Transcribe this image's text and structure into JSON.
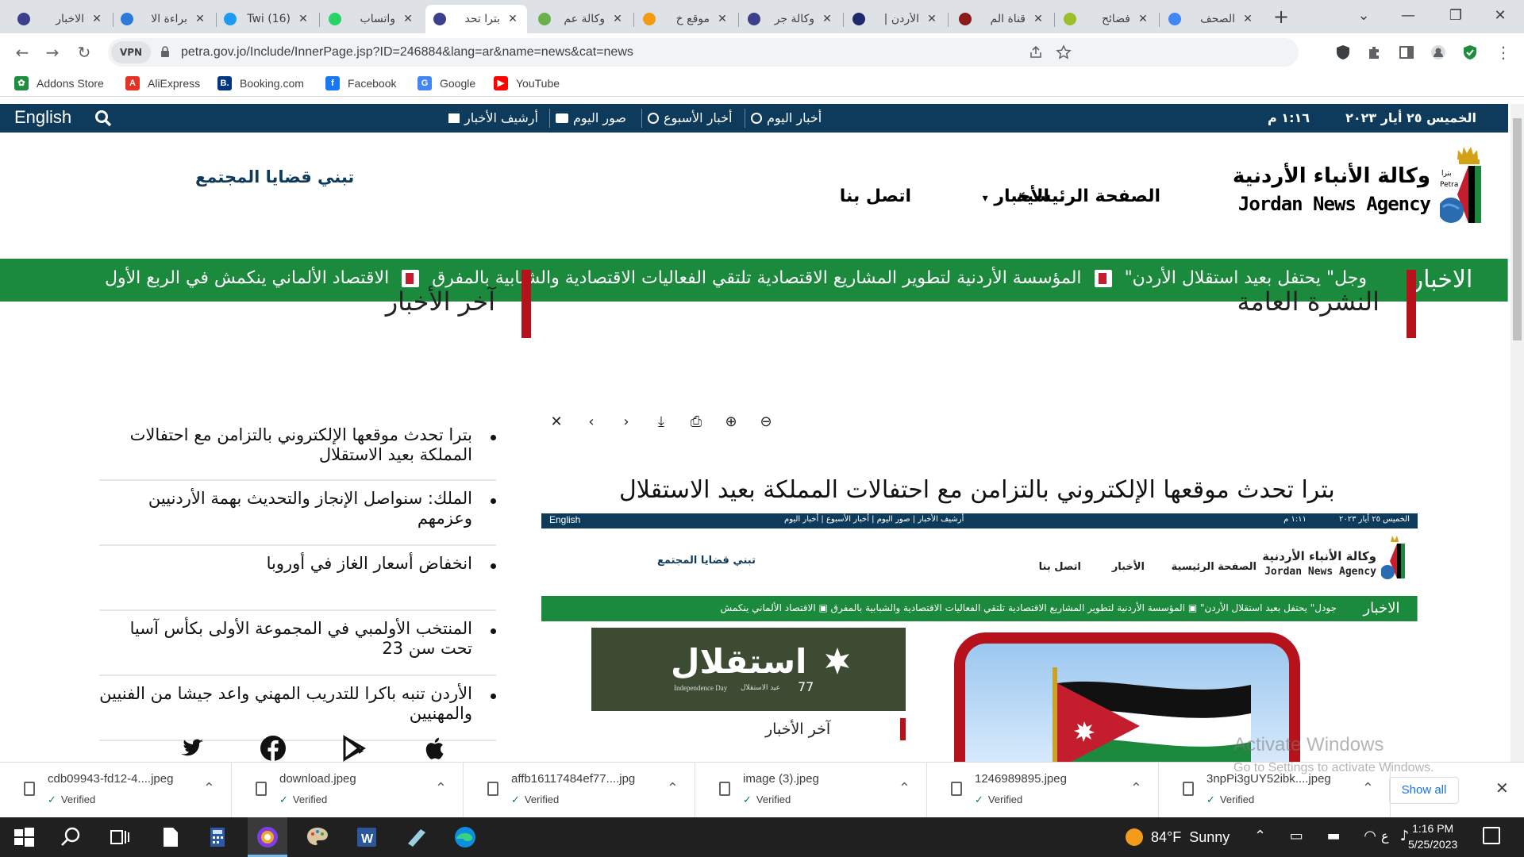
{
  "browser": {
    "tabs": [
      {
        "title": "الاخبار",
        "favicon_color": "#3b3f8c",
        "active": false
      },
      {
        "title": "براءة الا",
        "favicon_color": "#2a7bd5",
        "active": false
      },
      {
        "title": "(16) Twi",
        "favicon_color": "#1d9bf0",
        "active": false
      },
      {
        "title": "واتساب",
        "favicon_color": "#25d366",
        "active": false
      },
      {
        "title": "بترا تحد",
        "favicon_color": "#3b3f8c",
        "active": true
      },
      {
        "title": "وكالة عم",
        "favicon_color": "#6ab04c",
        "active": false
      },
      {
        "title": "موقع خ",
        "favicon_color": "#f39c12",
        "active": false
      },
      {
        "title": "وكالة جر",
        "favicon_color": "#3b3f8c",
        "active": false
      },
      {
        "title": "الأردن |",
        "favicon_color": "#1e2a6e",
        "active": false
      },
      {
        "title": "قناة الم",
        "favicon_color": "#8b1a1a",
        "active": false
      },
      {
        "title": "فضائح",
        "favicon_color": "#9bbf2a",
        "active": false
      },
      {
        "title": "الصحف",
        "favicon_color": "#4285f4",
        "active": false
      }
    ],
    "window_controls": {
      "menu": "⌄",
      "minimize": "—",
      "maximize": "❐",
      "close": "✕"
    },
    "url": "petra.gov.jo/Include/InnerPage.jsp?ID=246884&lang=ar&name=news&cat=news",
    "vpn_label": "VPN",
    "bookmarks": [
      {
        "label": "Addons Store",
        "color": "#1e8e3e",
        "glyph": "✿"
      },
      {
        "label": "AliExpress",
        "color": "#e43225",
        "glyph": "A"
      },
      {
        "label": "Booking.com",
        "color": "#003580",
        "glyph": "B."
      },
      {
        "label": "Facebook",
        "color": "#1877f2",
        "glyph": "f"
      },
      {
        "label": "Google",
        "color": "#4285f4",
        "glyph": "G"
      },
      {
        "label": "YouTube",
        "color": "#ff0000",
        "glyph": "▶"
      }
    ]
  },
  "site": {
    "top_bar": {
      "english": "English",
      "links": [
        "أرشيف الأخبار",
        "صور اليوم",
        "أخبار الأسبوع",
        "أخبار اليوم"
      ],
      "time": "١:١٦ م",
      "date": "الخميس ٢٥ أيار ٢٠٢٣"
    },
    "logo": {
      "arabic": "وكالة الأنباء الأردنية",
      "english": "Jordan News Agency",
      "badge": "بترا Petra"
    },
    "nav": {
      "home": "الصفحة الرئيسية",
      "news": "الأخبار",
      "news_arrow": "▾",
      "contact": "اتصل بنا"
    },
    "slogan": "تبني قضايا المجتمع",
    "ticker": {
      "label": "الاخبار",
      "items": [
        "وجل\" يحتفل بعيد استقلال الأردن\"",
        "المؤسسة الأردنية لتطوير المشاريع الاقتصادية تلتقي الفعاليات الاقتصادية والشبابية بالمفرق",
        "الاقتصاد الألماني ينكمش في الربع الأول"
      ]
    },
    "general_bulletin": "النشرة العامة",
    "latest_news_heading": "آخر الأخبار",
    "viewer_toolbar": [
      "zoom-out",
      "zoom-in",
      "print",
      "download",
      "next",
      "previous",
      "close"
    ],
    "viewer_glyphs": {
      "close": "✕",
      "previous": "‹",
      "next": "›",
      "download": "⤓",
      "print": "⎙",
      "zoom_in": "⊕",
      "zoom_out": "⊖"
    },
    "article_title": "بترا تحدث موقعها الإلكتروني بالتزامن مع احتفالات المملكة بعيد الاستقلال",
    "embedded": {
      "english": "English",
      "links": "أرشيف الأخبار  |  صور اليوم  |  أخبار الأسبوع  |  أخبار اليوم",
      "time": "١:١١ م",
      "date": "الخميس ٢٥ أيار ٢٠٢٣",
      "logo_ar": "وكالة الأنباء الأردنية",
      "logo_en": "Jordan News Agency",
      "nav_home": "الصفحة الرئيسية",
      "nav_news": "الأخبار",
      "nav_contact": "اتصل بنا",
      "slogan": "تبني قضايا المجتمع",
      "ticker_label": "الاخبار",
      "ticker_text": "جودل\" يحتفل بعيد استقلال الأردن\"  ▣ المؤسسة الأردنية لتطوير المشاريع الاقتصادية تلتقي الفعاليات الاقتصادية والشبابية بالمفرق  ▣ الاقتصاد الألماني ينكمش",
      "independence_ar": "استقلال",
      "independence_en": "Independence Day",
      "independence_sub": "عيد الاستقلال",
      "independence_num": "77",
      "latest_heading": "آخر الأخبار"
    },
    "latest_news": [
      "بترا تحدث موقعها الإلكتروني بالتزامن مع احتفالات المملكة بعيد الاستقلال",
      "الملك: سنواصل الإنجاز والتحديث بهمة الأردنيين وعزمهم",
      "انخفاض أسعار الغاز في أوروبا",
      "المنتخب الأولمبي في المجموعة الأولى بكأس آسيا تحت سن 23",
      "الأردن تنبه باكرا للتدريب المهني واعد جيشا من الفنيين والمهنيين"
    ],
    "social": [
      "twitter-icon",
      "facebook-icon",
      "google-play-icon",
      "apple-icon"
    ]
  },
  "downloads": {
    "items": [
      {
        "filename": "cdb09943-fd12-4....jpeg",
        "status": "Verified"
      },
      {
        "filename": "download.jpeg",
        "status": "Verified"
      },
      {
        "filename": "affb16117484ef77....jpg",
        "status": "Verified"
      },
      {
        "filename": "image (3).jpeg",
        "status": "Verified"
      },
      {
        "filename": "1246989895.jpeg",
        "status": "Verified"
      },
      {
        "filename": "3npPi3gUY52ibk....jpeg",
        "status": "Verified"
      }
    ],
    "show_all": "Show all",
    "close_glyph": "✕",
    "chevron_glyph": "⌃"
  },
  "watermark": {
    "line1": "Activate Windows",
    "line2": "Go to Settings to activate Windows."
  },
  "taskbar": {
    "temperature": "84°F",
    "condition": "Sunny",
    "language": "ع",
    "time": "1:16 PM",
    "date": "5/25/2023"
  }
}
